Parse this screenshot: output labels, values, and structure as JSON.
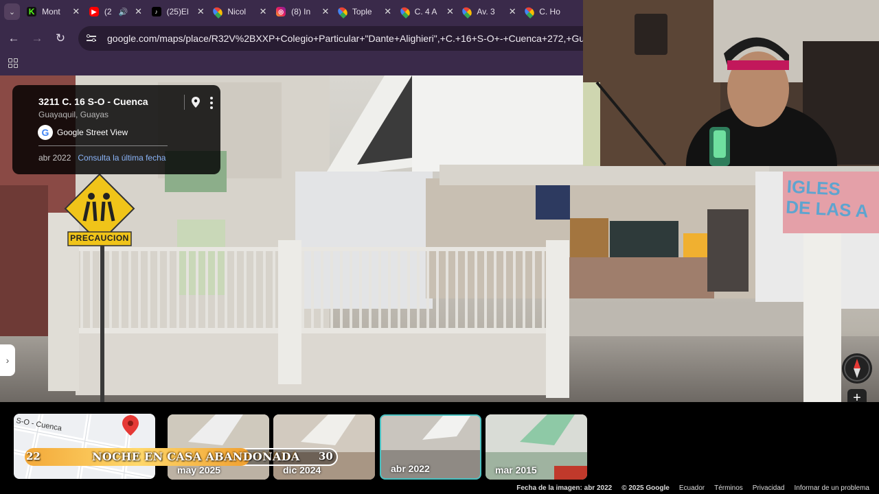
{
  "browser": {
    "tabs": [
      {
        "title": "Mont",
        "favicon": "kick-icon"
      },
      {
        "title": "(2",
        "favicon": "youtube-icon"
      },
      {
        "title": "(25)El",
        "favicon": "tiktok-icon"
      },
      {
        "title": "Nicol",
        "favicon": "maps-icon"
      },
      {
        "title": "(8) In",
        "favicon": "instagram-icon"
      },
      {
        "title": "Tople",
        "favicon": "maps-icon"
      },
      {
        "title": "C. 4 A",
        "favicon": "maps-icon"
      },
      {
        "title": "Av. 3",
        "favicon": "maps-icon"
      },
      {
        "title": "C. Ho",
        "favicon": "maps-icon"
      }
    ],
    "url": "google.com/maps/place/R32V%2BXXP+Colegio+Particular+\"Dante+Alighieri\",+C.+16+S-O+-+Cuenca+272,+Guayaquil+"
  },
  "info_card": {
    "address": "3211 C. 16 S-O - Cuenca",
    "city": "Guayaquil, Guayas",
    "source": "Google Street View",
    "date": "abr 2022",
    "latest_link": "Consulta la última fecha"
  },
  "scene": {
    "sign_text": "PRECAUCION",
    "church_text": "IGLES\nDE LAS A"
  },
  "controls": {
    "zoom_in": "+",
    "zoom_out": "−",
    "close": "✕",
    "expand": "›"
  },
  "minimap": {
    "street_label": "S-O - Cuenca"
  },
  "thumbnails": [
    {
      "label": "may 2025",
      "selected": false
    },
    {
      "label": "dic 2024",
      "selected": false
    },
    {
      "label": "abr 2022",
      "selected": true
    },
    {
      "label": "mar 2015",
      "selected": false
    }
  ],
  "banner": {
    "left": "22",
    "title": "NOCHE EN CASA ABANDONADA",
    "right": "30",
    "progress": 0.72
  },
  "footer": {
    "image_date": "Fecha de la imagen: abr 2022",
    "copyright": "© 2025 Google",
    "country": "Ecuador",
    "terms": "Términos",
    "privacy": "Privacidad",
    "report": "Informar de un problema"
  }
}
